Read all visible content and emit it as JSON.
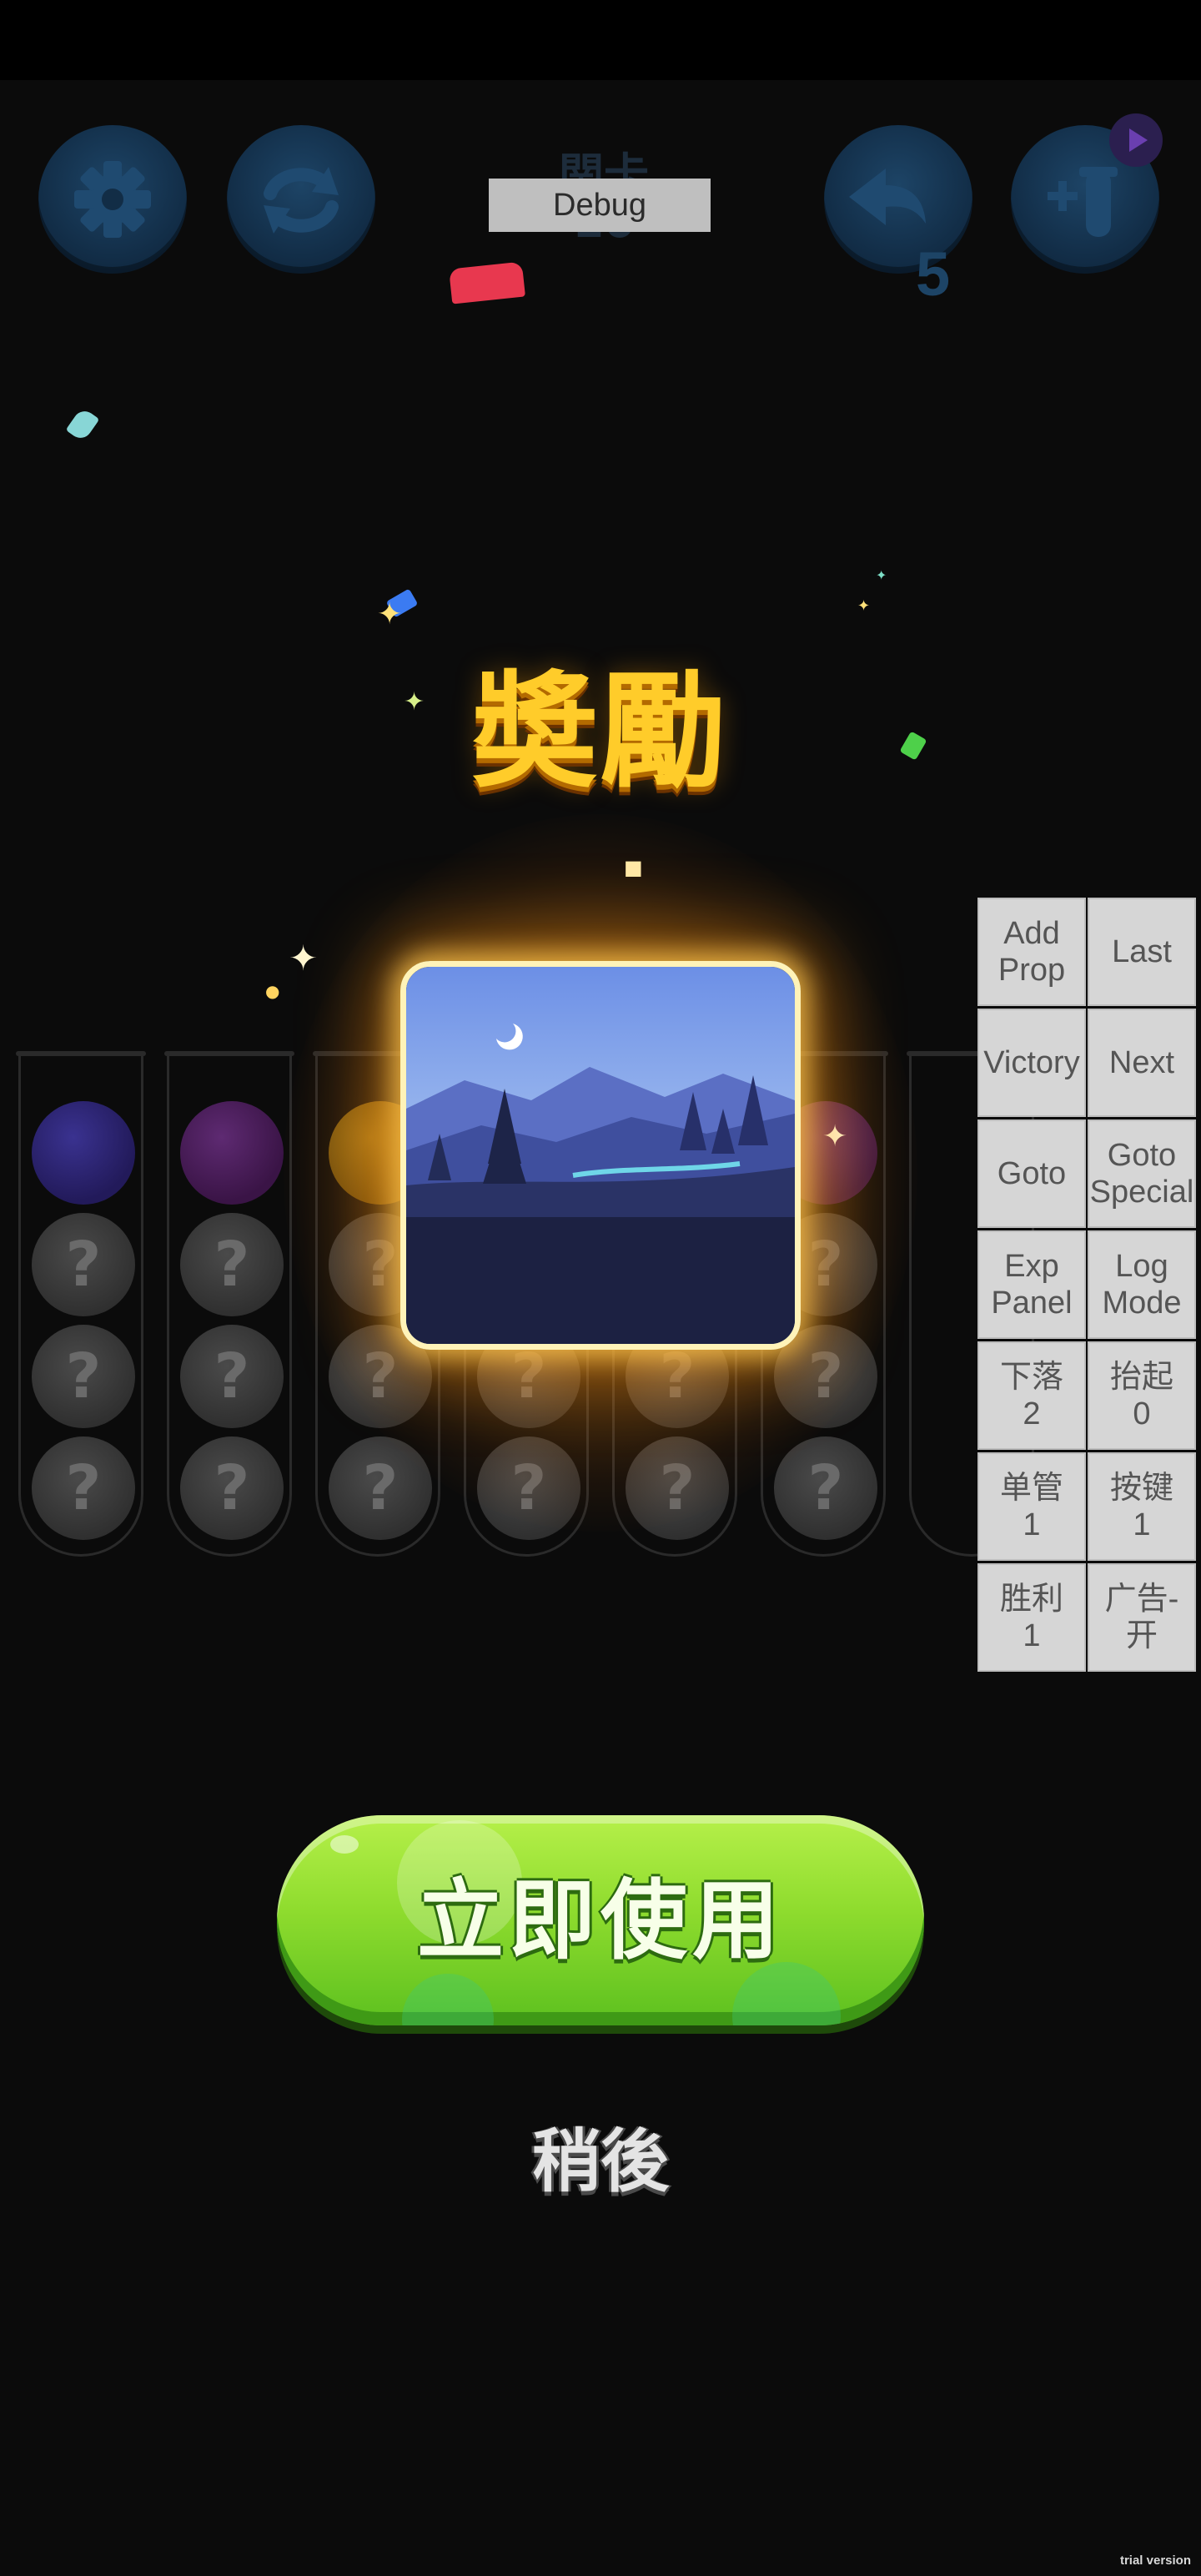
{
  "hud": {
    "settings_icon": "gear-icon",
    "restart_icon": "refresh-icon",
    "level_label": "関卡",
    "level_number": "10",
    "debug_label": "Debug",
    "undo_icon": "undo-arrow-icon",
    "undo_count": "5",
    "add_tube_icon": "add-tube-icon",
    "video_badge_icon": "play-video-icon"
  },
  "reward": {
    "title": "奬勵",
    "item_icon": "night-landscape-theme-icon"
  },
  "tubes": [
    {
      "top_color": "#2a2370",
      "hidden": [
        "?",
        "?",
        "?"
      ]
    },
    {
      "top_color": "#4c1e5c",
      "hidden": [
        "?",
        "?",
        "?"
      ]
    },
    {
      "top_color": "#7a5a10",
      "hidden": [
        "?",
        "?",
        "?"
      ]
    },
    {
      "top_color": "",
      "hidden": [
        "?",
        "?",
        "?"
      ]
    },
    {
      "top_color": "",
      "hidden": [
        "?",
        "?",
        "?"
      ]
    },
    {
      "top_color": "#4c1e5c",
      "hidden": [
        "?",
        "?",
        "?"
      ]
    },
    {
      "top_color": "",
      "hidden": []
    }
  ],
  "debug_panel": [
    {
      "label": "Add\nProp",
      "name": "add-prop-button"
    },
    {
      "label": "Last",
      "name": "last-button"
    },
    {
      "label": "Victory",
      "name": "victory-button"
    },
    {
      "label": "Next",
      "name": "next-button"
    },
    {
      "label": "Goto",
      "name": "goto-button"
    },
    {
      "label": "Goto\nSpecial",
      "name": "goto-special-button"
    },
    {
      "label": "Exp\nPanel",
      "name": "exp-panel-button"
    },
    {
      "label": "Log\nMode",
      "name": "log-mode-button"
    },
    {
      "label": "下落\n2",
      "name": "drop-button"
    },
    {
      "label": "抬起\n0",
      "name": "lift-button"
    },
    {
      "label": "单管\n1",
      "name": "single-tube-button"
    },
    {
      "label": "按键\n1",
      "name": "key-button"
    },
    {
      "label": "胜利\n1",
      "name": "win-button"
    },
    {
      "label": "广告-开",
      "name": "ads-toggle-button"
    }
  ],
  "actions": {
    "use_now": "立即使用",
    "later": "稍後"
  },
  "watermark": "trial version",
  "colors": {
    "title_gold": "#ffcc2a",
    "button_green": "#8fdc2e",
    "hud_blue": "#112b44"
  }
}
